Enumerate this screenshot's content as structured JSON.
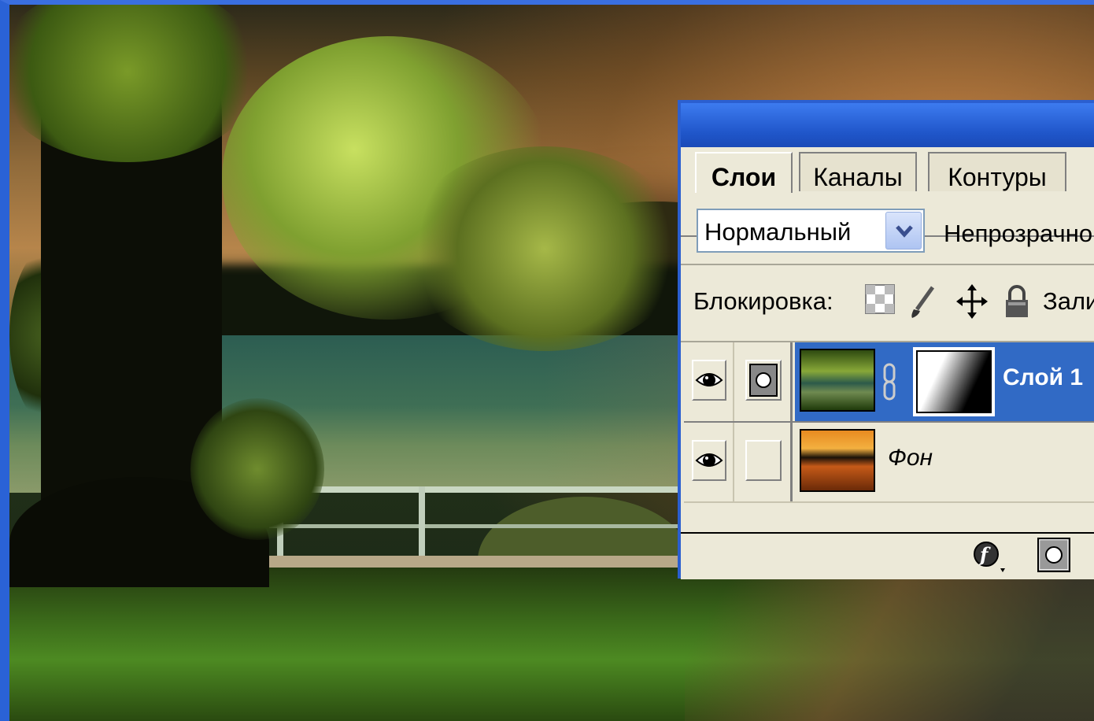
{
  "panel": {
    "tabs": [
      {
        "label": "Слои",
        "active": true
      },
      {
        "label": "Каналы",
        "active": false
      },
      {
        "label": "Контуры",
        "active": false
      }
    ],
    "blend_mode": "Нормальный",
    "opacity_label": "Непрозрачно",
    "lock_label": "Блокировка:",
    "fill_label": "Зали",
    "layers": [
      {
        "name": "Слой 1",
        "selected": true,
        "visible": true,
        "has_mask": true
      },
      {
        "name": "Фон",
        "selected": false,
        "visible": true,
        "has_mask": false
      }
    ],
    "footer_icons": [
      "layer-style-icon",
      "add-mask-icon"
    ]
  },
  "colors": {
    "window_blue": "#2b5fd0",
    "selection_blue": "#316ac5",
    "panel_bg": "#ece9d8"
  }
}
